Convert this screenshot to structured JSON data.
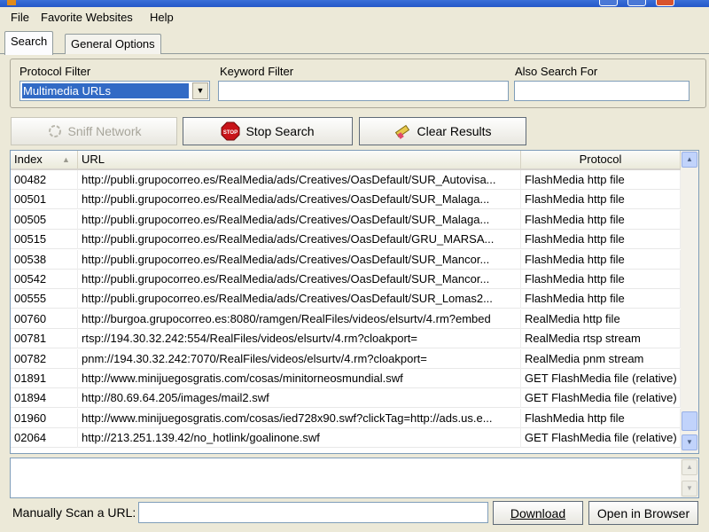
{
  "menu": [
    "File",
    "Favorite Websites",
    "Help"
  ],
  "tabs": [
    {
      "label": "Search",
      "active": true
    },
    {
      "label": "General Options",
      "active": false
    }
  ],
  "filters": {
    "protocol_label": "Protocol Filter",
    "protocol_value": "Multimedia URLs",
    "keyword_label": "Keyword Filter",
    "keyword_value": "",
    "also_label": "Also Search For",
    "also_value": ""
  },
  "buttons": {
    "sniff": "Sniff Network",
    "stop": "Stop Search",
    "clear": "Clear Results"
  },
  "table": {
    "columns": [
      "Index",
      "URL",
      "Protocol"
    ],
    "rows": [
      {
        "index": "00482",
        "url": "http://publi.grupocorreo.es/RealMedia/ads/Creatives/OasDefault/SUR_Autovisa...",
        "protocol": "FlashMedia http file"
      },
      {
        "index": "00501",
        "url": "http://publi.grupocorreo.es/RealMedia/ads/Creatives/OasDefault/SUR_Malaga...",
        "protocol": "FlashMedia http file"
      },
      {
        "index": "00505",
        "url": "http://publi.grupocorreo.es/RealMedia/ads/Creatives/OasDefault/SUR_Malaga...",
        "protocol": "FlashMedia http file"
      },
      {
        "index": "00515",
        "url": "http://publi.grupocorreo.es/RealMedia/ads/Creatives/OasDefault/GRU_MARSA...",
        "protocol": "FlashMedia http file"
      },
      {
        "index": "00538",
        "url": "http://publi.grupocorreo.es/RealMedia/ads/Creatives/OasDefault/SUR_Mancor...",
        "protocol": "FlashMedia http file"
      },
      {
        "index": "00542",
        "url": "http://publi.grupocorreo.es/RealMedia/ads/Creatives/OasDefault/SUR_Mancor...",
        "protocol": "FlashMedia http file"
      },
      {
        "index": "00555",
        "url": "http://publi.grupocorreo.es/RealMedia/ads/Creatives/OasDefault/SUR_Lomas2...",
        "protocol": "FlashMedia http file"
      },
      {
        "index": "00760",
        "url": "http://burgoa.grupocorreo.es:8080/ramgen/RealFiles/videos/elsurtv/4.rm?embed",
        "protocol": "RealMedia http file"
      },
      {
        "index": "00781",
        "url": "rtsp://194.30.32.242:554/RealFiles/videos/elsurtv/4.rm?cloakport=",
        "protocol": "RealMedia rtsp stream"
      },
      {
        "index": "00782",
        "url": "pnm://194.30.32.242:7070/RealFiles/videos/elsurtv/4.rm?cloakport=",
        "protocol": "RealMedia pnm stream"
      },
      {
        "index": "01891",
        "url": "http://www.minijuegosgratis.com/cosas/minitorneosmundial.swf",
        "protocol": "GET FlashMedia file (relative)"
      },
      {
        "index": "01894",
        "url": "http://80.69.64.205/images/mail2.swf",
        "protocol": "GET FlashMedia file (relative)"
      },
      {
        "index": "01960",
        "url": "http://www.minijuegosgratis.com/cosas/ied728x90.swf?clickTag=http://ads.us.e...",
        "protocol": "FlashMedia http file"
      },
      {
        "index": "02064",
        "url": "http://213.251.139.42/no_hotlink/goalinone.swf",
        "protocol": "GET FlashMedia file (relative)"
      }
    ]
  },
  "bottom": {
    "manual_label": "Manually Scan a URL:",
    "manual_value": "",
    "download": "Download",
    "open": "Open in Browser"
  },
  "colors": {
    "selection": "#316ac5",
    "stop_icon": "#c8141a"
  }
}
